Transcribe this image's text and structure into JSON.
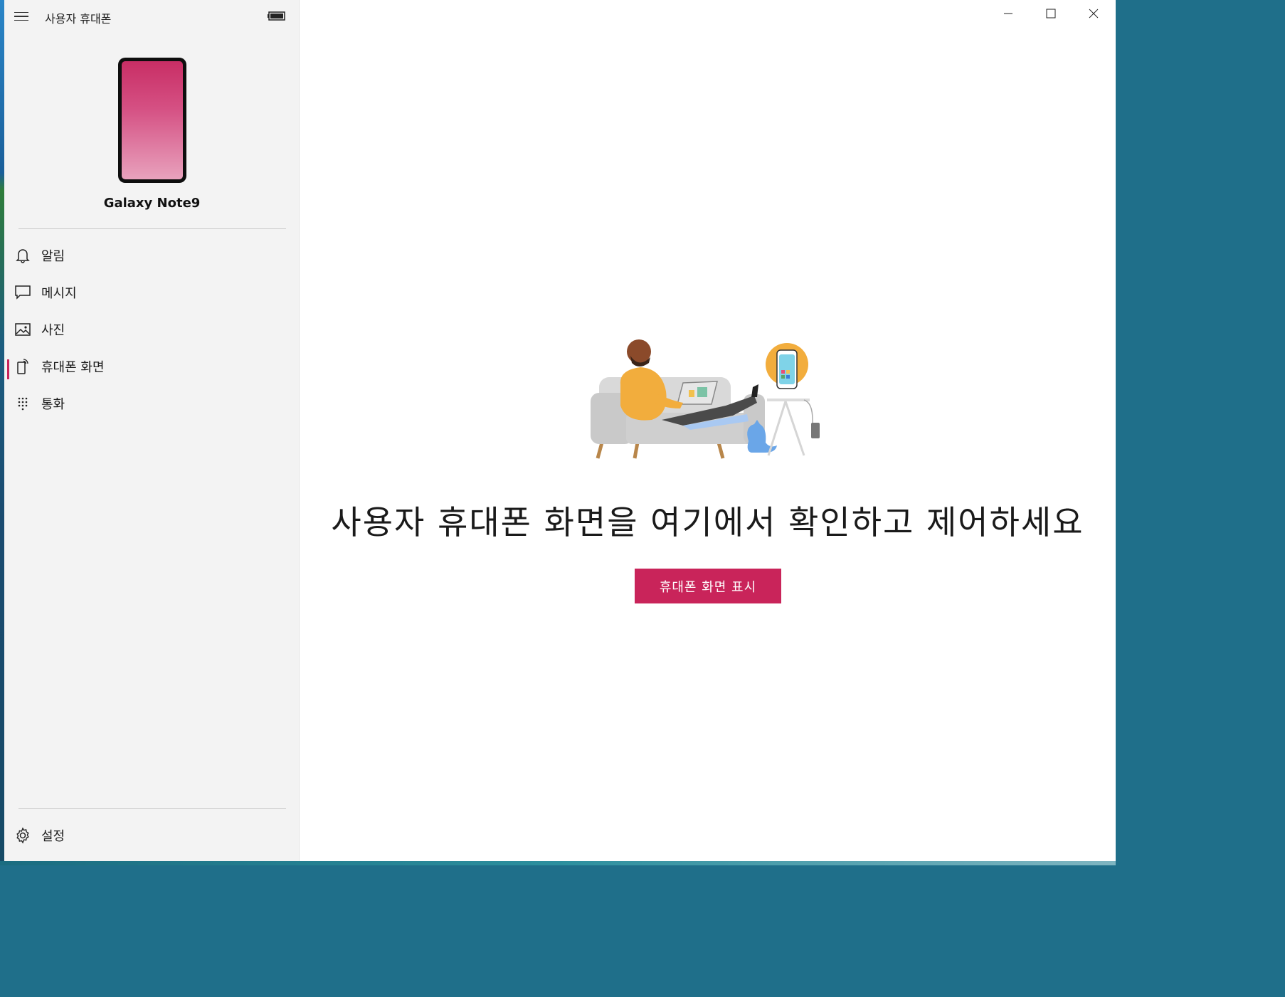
{
  "app": {
    "title": "사용자 휴대폰",
    "device_name": "Galaxy Note9"
  },
  "sidebar": {
    "items": [
      {
        "label": "알림",
        "icon": "bell-icon"
      },
      {
        "label": "메시지",
        "icon": "message-icon"
      },
      {
        "label": "사진",
        "icon": "photo-icon"
      },
      {
        "label": "휴대폰 화면",
        "icon": "phone-screen-icon",
        "active": true
      },
      {
        "label": "통화",
        "icon": "dialpad-icon"
      }
    ],
    "settings_label": "설정"
  },
  "main": {
    "headline": "사용자 휴대폰 화면을 여기에서 확인하고 제어하세요",
    "cta_label": "휴대폰 화면 표시"
  },
  "colors": {
    "accent": "#c9245a",
    "sidebar_bg": "#f3f3f3",
    "phone_gradient_top": "#c82e65",
    "phone_gradient_bottom": "#e8a2bd"
  }
}
